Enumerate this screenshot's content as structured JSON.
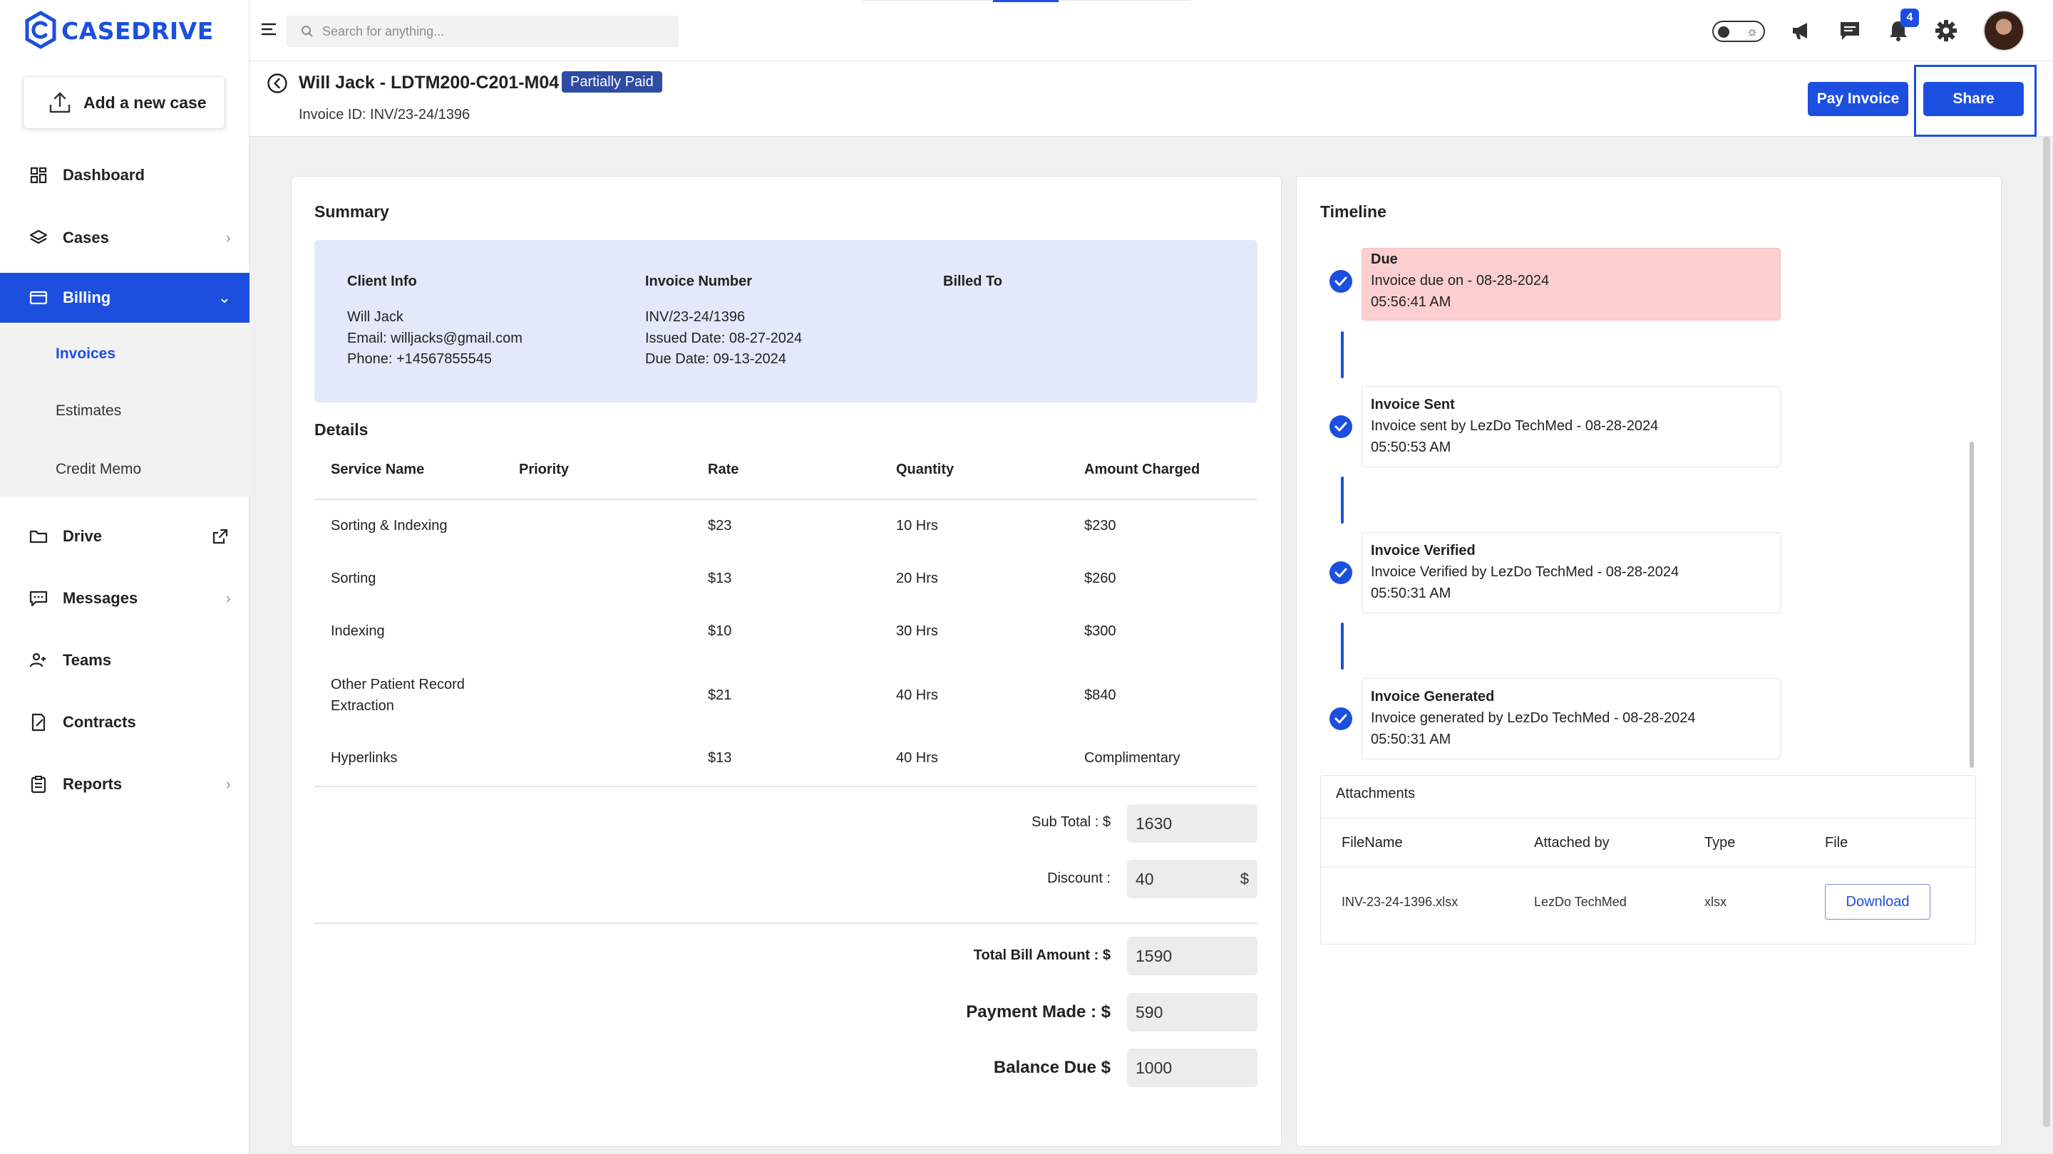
{
  "app": {
    "brand": "CASEDRIVE"
  },
  "sidebar": {
    "add_case": "Add a new case",
    "items": [
      {
        "label": "Dashboard"
      },
      {
        "label": "Cases"
      },
      {
        "label": "Billing"
      },
      {
        "label": "Drive"
      },
      {
        "label": "Messages"
      },
      {
        "label": "Teams"
      },
      {
        "label": "Contracts"
      },
      {
        "label": "Reports"
      }
    ],
    "billing_sub": [
      {
        "label": "Invoices"
      },
      {
        "label": "Estimates"
      },
      {
        "label": "Credit Memo"
      }
    ]
  },
  "topbar": {
    "search_placeholder": "Search for anything...",
    "notification_count": "4"
  },
  "invoice": {
    "title": "Will Jack - LDTM200-C201-M04",
    "status": "Partially Paid",
    "id_line": "Invoice ID: INV/23-24/1396",
    "pay_button": "Pay Invoice",
    "share_button": "Share"
  },
  "summary": {
    "title": "Summary",
    "client_info": {
      "heading": "Client Info",
      "name": "Will Jack",
      "email": "Email: willjacks@gmail.com",
      "phone": "Phone: +14567855545"
    },
    "invoice_number": {
      "heading": "Invoice Number",
      "number": "INV/23-24/1396",
      "issued": "Issued Date: 08-27-2024",
      "due": "Due Date: 09-13-2024"
    },
    "billed_to": {
      "heading": "Billed To"
    }
  },
  "details": {
    "title": "Details",
    "columns": [
      "Service Name",
      "Priority",
      "Rate",
      "Quantity",
      "Amount Charged"
    ],
    "rows": [
      {
        "service": "Sorting & Indexing",
        "priority": "",
        "rate": "$23",
        "quantity": "10 Hrs",
        "amount": "$230"
      },
      {
        "service": "Sorting",
        "priority": "",
        "rate": "$13",
        "quantity": "20 Hrs",
        "amount": "$260"
      },
      {
        "service": "Indexing",
        "priority": "",
        "rate": "$10",
        "quantity": "30 Hrs",
        "amount": "$300"
      },
      {
        "service_line1": "Other Patient Record",
        "service_line2": "Extraction",
        "priority": "",
        "rate": "$21",
        "quantity": "40 Hrs",
        "amount": "$840"
      },
      {
        "service": "Hyperlinks",
        "priority": "",
        "rate": "$13",
        "quantity": "40 Hrs",
        "amount": "Complimentary"
      }
    ]
  },
  "totals": {
    "subtotal_label": "Sub Total : $",
    "subtotal_value": "1630",
    "discount_label": "Discount :",
    "discount_value": "40",
    "discount_unit": "$",
    "total_label": "Total Bill Amount : $",
    "total_value": "1590",
    "payment_label": "Payment Made : $",
    "payment_value": "590",
    "balance_label": "Balance Due $",
    "balance_value": "1000"
  },
  "timeline": {
    "title": "Timeline",
    "events": [
      {
        "title": "Due",
        "text": "Invoice due on - 08-28-2024",
        "time": "05:56:41 AM"
      },
      {
        "title": "Invoice Sent",
        "text": "Invoice sent by LezDo TechMed - 08-28-2024",
        "time": "05:50:53 AM"
      },
      {
        "title": "Invoice Verified",
        "text": "Invoice Verified by LezDo TechMed - 08-28-2024",
        "time": "05:50:31 AM"
      },
      {
        "title": "Invoice Generated",
        "text": "Invoice generated by LezDo TechMed - 08-28-2024",
        "time": "05:50:31 AM"
      }
    ]
  },
  "attachments": {
    "title": "Attachments",
    "columns": [
      "FileName",
      "Attached by",
      "Type",
      "File"
    ],
    "rows": [
      {
        "filename": "INV-23-24-1396.xlsx",
        "attached_by": "LezDo TechMed",
        "type": "xlsx",
        "action": "Download"
      }
    ]
  },
  "colors": {
    "accent": "#1c4fe0",
    "status_badge": "#2f4ca3",
    "summary_bg": "#e3e8fb",
    "due_bg": "#fbcfcf"
  },
  "icons": [
    "upload-icon",
    "dashboard-icon",
    "layers-icon",
    "billing-card-icon",
    "folder-icon",
    "external-link-icon",
    "message-icon",
    "teams-icon",
    "contract-icon",
    "reports-icon",
    "menu-icon",
    "search-icon",
    "theme-toggle-icon",
    "megaphone-icon",
    "chat-icon",
    "bell-icon",
    "gear-icon",
    "back-arrow-icon",
    "check-circle-icon"
  ]
}
